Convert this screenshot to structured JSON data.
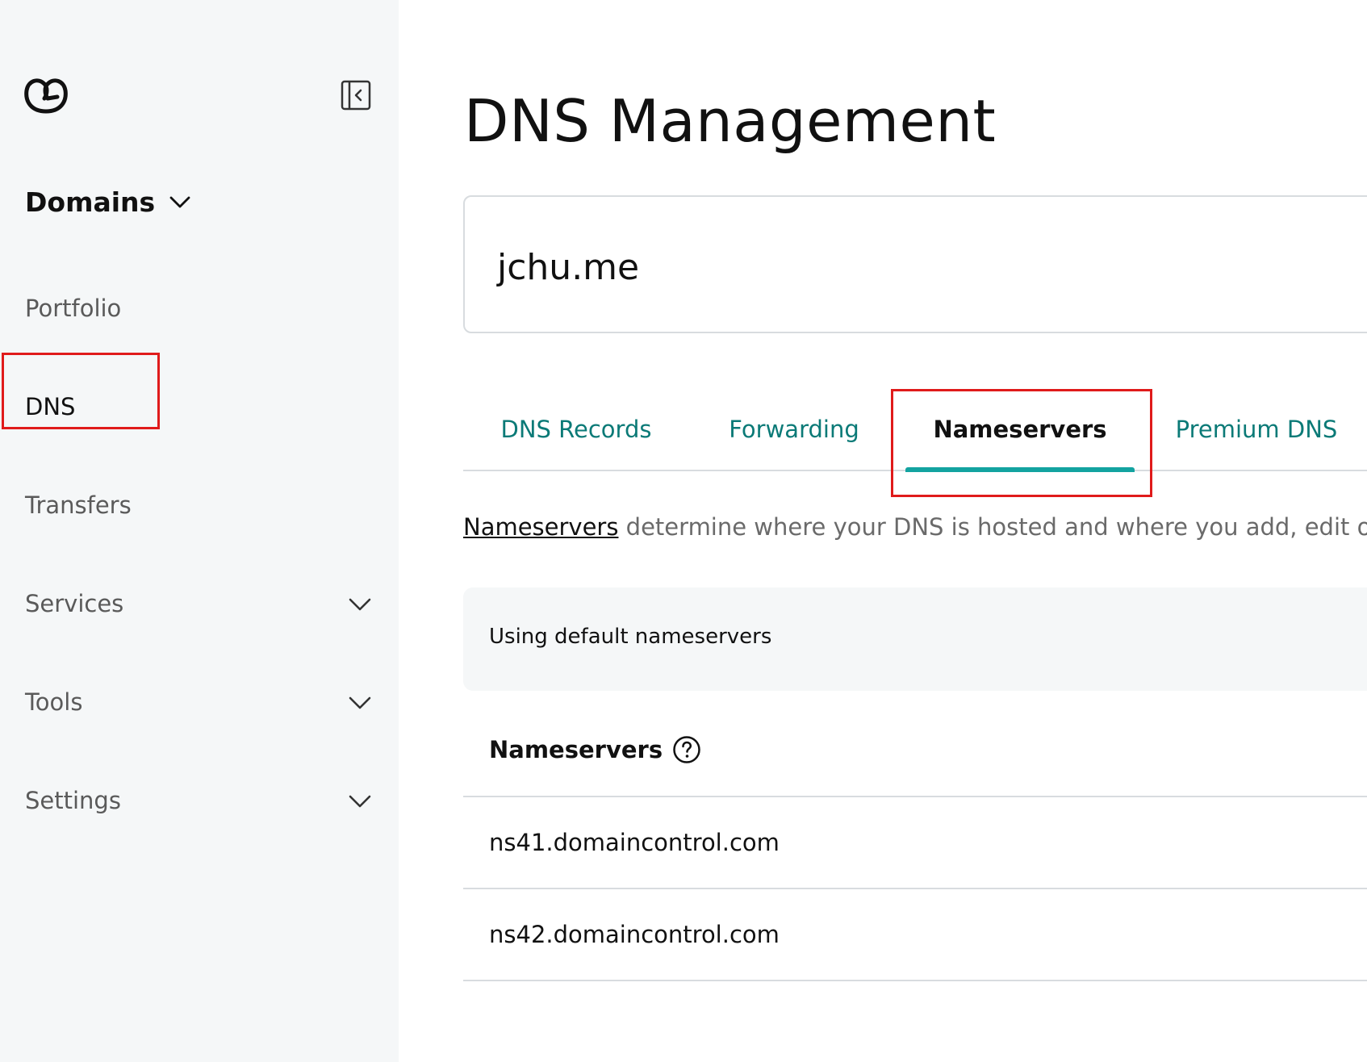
{
  "sidebar": {
    "product_label": "Domains",
    "items": [
      {
        "label": "Portfolio",
        "has_chevron": false,
        "active": false
      },
      {
        "label": "DNS",
        "has_chevron": false,
        "active": true
      },
      {
        "label": "Transfers",
        "has_chevron": false,
        "active": false
      },
      {
        "label": "Services",
        "has_chevron": true,
        "active": false
      },
      {
        "label": "Tools",
        "has_chevron": true,
        "active": false
      },
      {
        "label": "Settings",
        "has_chevron": true,
        "active": false
      }
    ]
  },
  "main": {
    "title": "DNS Management",
    "domain": "jchu.me",
    "tabs": [
      {
        "label": "DNS Records",
        "active": false
      },
      {
        "label": "Forwarding",
        "active": false
      },
      {
        "label": "Nameservers",
        "active": true
      },
      {
        "label": "Premium DNS",
        "active": false
      }
    ],
    "description": {
      "link_text": "Nameservers",
      "rest": " determine where your DNS is hosted and where you add, edit or c"
    },
    "info_panel_text": "Using default nameservers",
    "nameservers_title": "Nameservers",
    "nameservers": [
      "ns41.domaincontrol.com",
      "ns42.domaincontrol.com"
    ]
  },
  "colors": {
    "sidebar_bg": "#f5f7f8",
    "accent_teal": "#13a3a0",
    "tab_text_teal": "#0b7a77",
    "highlight_red": "#e01b1b",
    "divider": "#d8dcdf"
  },
  "icons": {
    "logo": "godaddy-logo-icon",
    "collapse": "sidebar-collapse-icon",
    "chevron": "chevron-down-icon",
    "help": "help-circle-icon"
  }
}
